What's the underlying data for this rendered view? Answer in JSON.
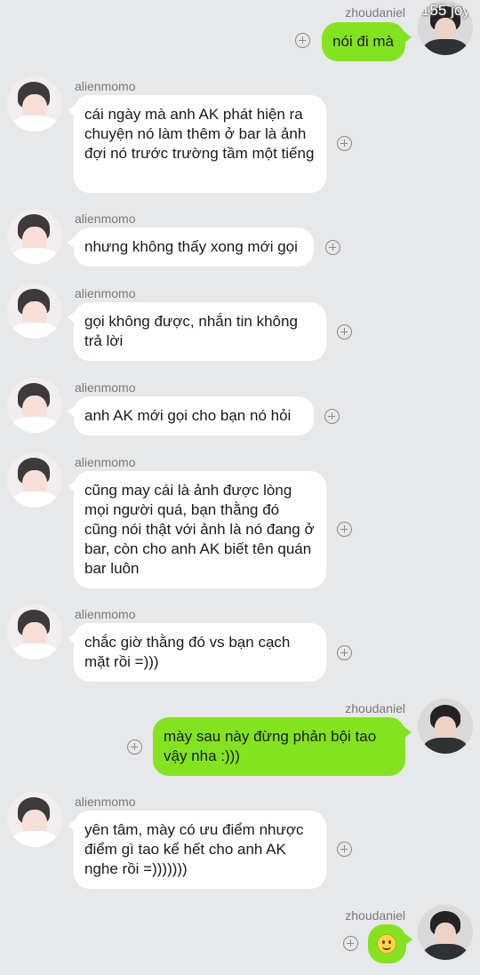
{
  "chat": {
    "self_name": "zhoudaniel",
    "other_name": "alienmomo",
    "self_avatar_overlay": "155 joy",
    "messages": [
      {
        "from": "zhoudaniel",
        "name": "zhoudaniel",
        "text": "nói đi mà"
      },
      {
        "from": "alienmomo",
        "name": "alienmomo",
        "text": "cái ngày mà anh AK phát hiện ra chuyện nó làm thêm ở bar là ảnh đợi nó trước trường tầm một tiếng"
      },
      {
        "from": "alienmomo",
        "name": "alienmomo",
        "text": "nhưng không thấy xong mới gọi"
      },
      {
        "from": "alienmomo",
        "name": "alienmomo",
        "text": "gọi không được, nhắn tin không trả lời"
      },
      {
        "from": "alienmomo",
        "name": "alienmomo",
        "text": "anh AK mới gọi cho bạn nó hỏi"
      },
      {
        "from": "alienmomo",
        "name": "alienmomo",
        "text": "cũng may cái là ảnh được lòng mọi người quá, bạn thằng đó cũng nói thật với ảnh là nó đang ở bar, còn cho anh AK biết tên quán bar luôn"
      },
      {
        "from": "alienmomo",
        "name": "alienmomo",
        "text": "chắc giờ thằng đó vs bạn cạch mặt rồi =)))"
      },
      {
        "from": "zhoudaniel",
        "name": "zhoudaniel",
        "text": "mày sau này đừng phản bội tao vậy nha :)))"
      },
      {
        "from": "alienmomo",
        "name": "alienmomo",
        "text": "yên tâm, mày có ưu điểm nhược điểm gì tao kể hết cho anh AK nghe rồi =)))))))"
      },
      {
        "from": "zhoudaniel",
        "name": "zhoudaniel",
        "text": "",
        "sticker": "smiley-emoji"
      }
    ]
  },
  "colors": {
    "background": "#e7e8ea",
    "incoming_bubble": "#ffffff",
    "outgoing_bubble": "#84e31f",
    "name_text": "#7a7a7a"
  },
  "icons": {
    "add": "plus-circle-icon",
    "sticker": "smiley-emoji-icon"
  }
}
